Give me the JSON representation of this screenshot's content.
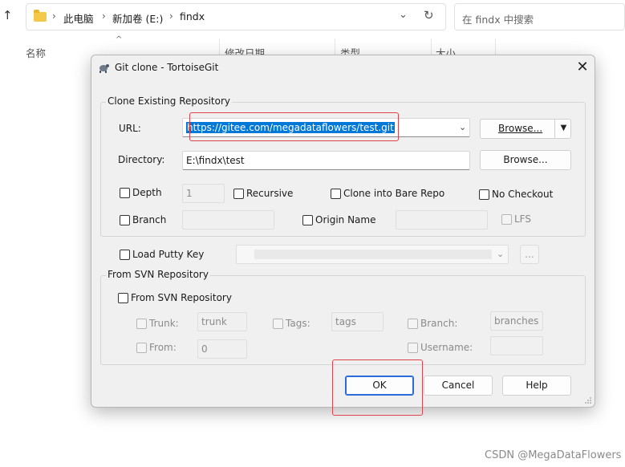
{
  "explorer": {
    "breadcrumbs": [
      "此电脑",
      "新加卷 (E:)",
      "findx"
    ],
    "search_placeholder": "在 findx 中搜索",
    "columns": [
      "名称",
      "修改日期",
      "类型",
      "大小"
    ]
  },
  "dialog": {
    "title": "Git clone - TortoiseGit",
    "clone_group": {
      "title": "Clone Existing Repository",
      "url_label": "URL:",
      "url_value": "https://gitee.com/megadataflowers/test.git",
      "url_browse": "Browse...",
      "directory_label": "Directory:",
      "directory_value": "E:\\findx\\test",
      "directory_browse": "Browse...",
      "depth_label": "Depth",
      "depth_value": "1",
      "recursive_label": "Recursive",
      "bare_label": "Clone into Bare Repo",
      "no_checkout_label": "No Checkout",
      "branch_label": "Branch",
      "branch_value": "",
      "origin_name_label": "Origin Name",
      "origin_name_value": "",
      "lfs_label": "LFS"
    },
    "putty": {
      "label": "Load Putty Key",
      "value": "",
      "browse": "..."
    },
    "svn_group": {
      "title": "From SVN Repository",
      "from_svn_label": "From SVN Repository",
      "trunk_label": "Trunk:",
      "trunk_value": "trunk",
      "tags_label": "Tags:",
      "tags_value": "tags",
      "branch_label": "Branch:",
      "branch_value": "branches",
      "from_label": "From:",
      "from_value": "0",
      "username_label": "Username:",
      "username_value": ""
    },
    "buttons": {
      "ok": "OK",
      "cancel": "Cancel",
      "help": "Help"
    }
  },
  "colors": {
    "highlight": "#e0424b",
    "selection": "#0078d7",
    "default_button": "#2b6ad8"
  },
  "watermark": "CSDN @MegaDataFlowers"
}
